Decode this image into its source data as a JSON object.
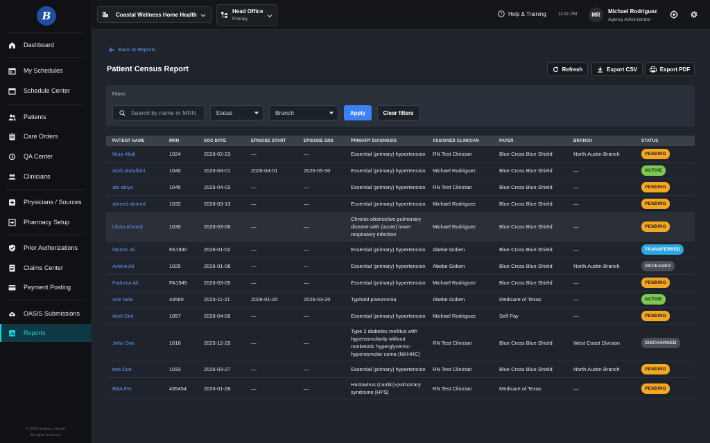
{
  "sidebar": {
    "logo_text": "B",
    "items": [
      {
        "label": "Dashboard",
        "icon": "home-icon"
      },
      {
        "label": "My Schedules",
        "icon": "calendar-icon"
      },
      {
        "label": "Schedule Center",
        "icon": "calendar-grid-icon"
      },
      {
        "label": "Patients",
        "icon": "users-icon"
      },
      {
        "label": "Care Orders",
        "icon": "clipboard-icon"
      },
      {
        "label": "QA Center",
        "icon": "history-icon"
      },
      {
        "label": "Clinicians",
        "icon": "people-icon"
      },
      {
        "label": "Physicians / Sources",
        "icon": "plus-square-icon"
      },
      {
        "label": "Pharmacy Setup",
        "icon": "pharmacy-icon"
      },
      {
        "label": "Prior Authorizations",
        "icon": "shield-check-icon"
      },
      {
        "label": "Claims Center",
        "icon": "document-icon"
      },
      {
        "label": "Payment Posting",
        "icon": "credit-card-icon"
      },
      {
        "label": "OASIS Submissions",
        "icon": "cloud-upload-icon"
      },
      {
        "label": "Reports",
        "icon": "chart-icon"
      }
    ],
    "footer_line1": "© 2026 Bethany Health",
    "footer_line2": "All rights reserved."
  },
  "topbar": {
    "agency": "Coastal Wellness Home Health",
    "office": "Head Office",
    "office_sub": "Primary",
    "help": "Help & Training",
    "time": "11:31 PM",
    "avatar": "MR",
    "user_name": "Michael Rodriguez",
    "user_role": "Agency Administrator"
  },
  "page": {
    "back": "Back to Reports",
    "title": "Patient Census Report",
    "refresh": "Refresh",
    "export_csv": "Export CSV",
    "export_pdf": "Export PDF"
  },
  "filters": {
    "label": "Filters",
    "search_placeholder": "Search by name or MRN",
    "status": "Status",
    "branch": "Branch",
    "apply": "Apply",
    "clear": "Clear filters"
  },
  "table": {
    "headers": [
      "PATIENT NAME",
      "MRN",
      "SOC DATE",
      "EPISODE START",
      "EPISODE END",
      "PRIMARY DIAGNOSIS",
      "ASSIGNED CLINICIAN",
      "PAYER",
      "BRANCH",
      "STATUS"
    ],
    "rows": [
      {
        "name": "Nuur Abdi",
        "mrn": "1024",
        "soc": "2026-02-23",
        "start": "—",
        "end": "—",
        "dx": "Essential (primary) hypertension",
        "clin": "RN Test Clinician",
        "payer": "Blue Cross Blue Shield",
        "branch": "North Austin Branch",
        "status": "PENDING"
      },
      {
        "name": "Abdi abdullahi",
        "mrn": "1040",
        "soc": "2026-04-01",
        "start": "2026-04-01",
        "end": "2026-05-30",
        "dx": "Essential (primary) hypertension",
        "clin": "Michael Rodriguez",
        "payer": "Blue Cross Blue Shield",
        "branch": "—",
        "status": "ACTIVE"
      },
      {
        "name": "abi abiyo",
        "mrn": "1045",
        "soc": "2026-04-03",
        "start": "—",
        "end": "—",
        "dx": "Essential (primary) hypertension",
        "clin": "RN Test Clinician",
        "payer": "Blue Cross Blue Shield",
        "branch": "—",
        "status": "PENDING"
      },
      {
        "name": "ahmed ahmed",
        "mrn": "1032",
        "soc": "2026-03-13",
        "start": "—",
        "end": "—",
        "dx": "Essential (primary) hypertension",
        "clin": "Michael Rodriguez",
        "payer": "Blue Cross Blue Shield",
        "branch": "—",
        "status": "PENDING"
      },
      {
        "name": "Liban Ahmed",
        "mrn": "1030",
        "soc": "2026-03-06",
        "start": "—",
        "end": "—",
        "dx": "Chronic obstructive pulmonary disease with (acute) lower respiratory infection",
        "clin": "Michael Rodriguez",
        "payer": "Blue Cross Blue Shield",
        "branch": "—",
        "status": "PENDING"
      },
      {
        "name": "fatumo ali",
        "mrn": "FA1940",
        "soc": "2026-01-02",
        "start": "—",
        "end": "—",
        "dx": "Essential (primary) hypertension",
        "clin": "Abebe Goben",
        "payer": "Blue Cross Blue Shield",
        "branch": "—",
        "status": "TRANSFERRED"
      },
      {
        "name": "Amina Ali",
        "mrn": "1025",
        "soc": "2026-01-08",
        "start": "—",
        "end": "—",
        "dx": "Essential (primary) hypertension",
        "clin": "Abebe Goben",
        "payer": "Blue Cross Blue Shield",
        "branch": "North Austin Branch",
        "status": "DECEASED"
      },
      {
        "name": "Fadumo Ali",
        "mrn": "FA1945",
        "soc": "2026-03-05",
        "start": "—",
        "end": "—",
        "dx": "Essential (primary) hypertension",
        "clin": "Michael Rodriguez",
        "payer": "Blue Cross Blue Shield",
        "branch": "—",
        "status": "PENDING"
      },
      {
        "name": "Abe bela",
        "mrn": "43560",
        "soc": "2025-11-21",
        "start": "2026-01-20",
        "end": "2026-03-20",
        "dx": "Typhoid pneumonia",
        "clin": "Abebe Goben",
        "payer": "Medicare of Texas",
        "branch": "—",
        "status": "ACTIVE"
      },
      {
        "name": "Abdi Dirir",
        "mrn": "1057",
        "soc": "2026-04-09",
        "start": "—",
        "end": "—",
        "dx": "Essential (primary) hypertension",
        "clin": "Michael Rodriguez",
        "payer": "Self Pay",
        "branch": "—",
        "status": "PENDING"
      },
      {
        "name": "John Doe",
        "mrn": "1016",
        "soc": "2025-12-29",
        "start": "—",
        "end": "—",
        "dx": "Type 2 diabetes mellitus with hyperosmolarity without nonketotic hyperglycemic-hyperosmolar coma (NKHHC)",
        "clin": "RN Test Clinician",
        "payer": "Blue Cross Blue Shield",
        "branch": "West Coast Division",
        "status": "DISCHARGED"
      },
      {
        "name": "test Due",
        "mrn": "1033",
        "soc": "2026-03-27",
        "start": "—",
        "end": "—",
        "dx": "Essential (primary) hypertension",
        "clin": "RN Test Clinician",
        "payer": "Blue Cross Blue Shield",
        "branch": "North Austin Branch",
        "status": "PENDING"
      },
      {
        "name": "BBA Fer",
        "mrn": "435454",
        "soc": "2026-01-28",
        "start": "—",
        "end": "—",
        "dx": "Hantavirus (cardio)-pulmonary syndrome [HPS]",
        "clin": "RN Test Clinician",
        "payer": "Medicare of Texas",
        "branch": "—",
        "status": "PENDING"
      }
    ]
  },
  "status_colors": {
    "PENDING": "#f5a623",
    "ACTIVE": "#7bc950",
    "TRANSFERRED": "#2aa7e0",
    "DECEASED": "#4a4f57",
    "DISCHARGED": "#4a4f57"
  }
}
